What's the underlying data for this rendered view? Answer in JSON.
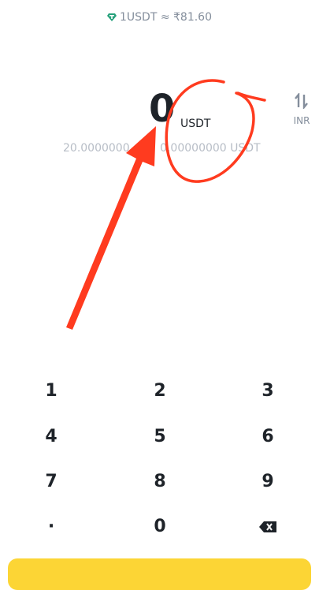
{
  "rate": {
    "text": "1USDT ≈ ₹81.60",
    "icon": "tether-icon"
  },
  "amount": {
    "value": "0",
    "unit": "USDT"
  },
  "swap": {
    "label": "INR",
    "icon": "swap-icon"
  },
  "limits": {
    "min": "20.0000000",
    "max": "0.00000000 USDT"
  },
  "keypad": {
    "keys": [
      "1",
      "2",
      "3",
      "4",
      "5",
      "6",
      "7",
      "8",
      "9",
      "·",
      "0"
    ],
    "backspace_icon": "backspace-icon"
  },
  "colors": {
    "accent": "#fcd535",
    "annotation": "#ff3b1f",
    "muted": "#848e9c"
  }
}
